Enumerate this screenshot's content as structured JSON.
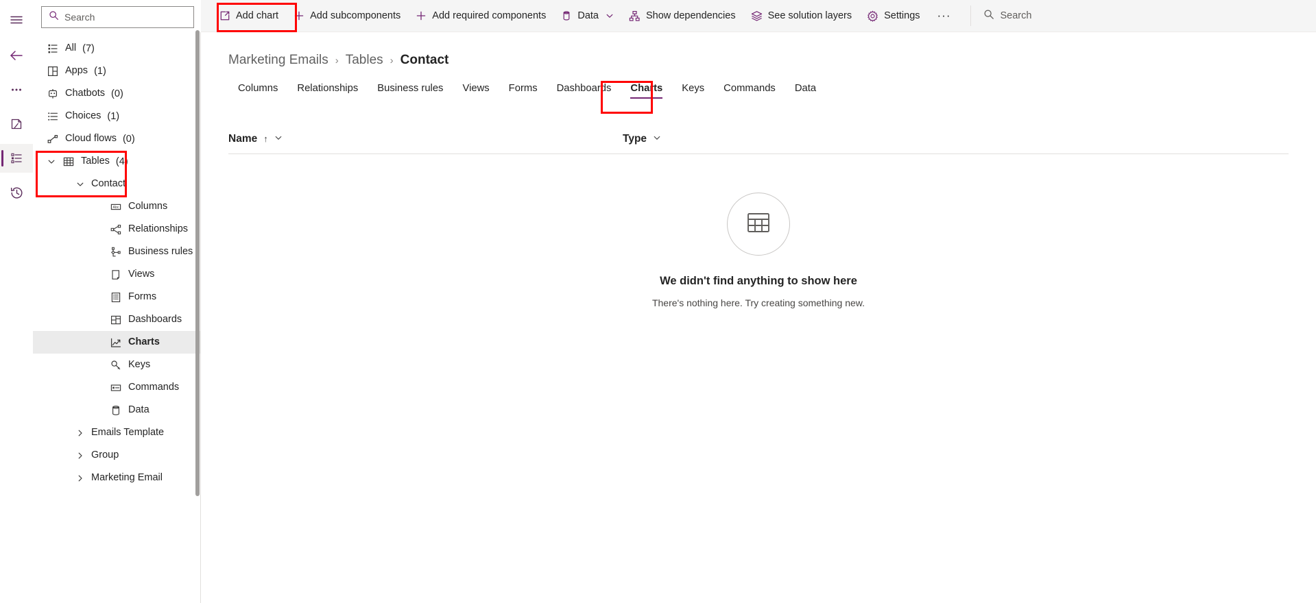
{
  "rail": {
    "items": [
      {
        "name": "hamburger-menu-icon",
        "label": "Menu"
      },
      {
        "name": "back-arrow-icon",
        "label": "Back"
      },
      {
        "name": "more-options-icon",
        "label": "More"
      },
      {
        "name": "solutions-icon",
        "label": "Solutions"
      },
      {
        "name": "objects-list-icon",
        "label": "Objects"
      },
      {
        "name": "recent-history-icon",
        "label": "Recent"
      }
    ]
  },
  "sidebar": {
    "search": {
      "placeholder": "Search"
    },
    "items": [
      {
        "label": "All",
        "count": "(7)",
        "icon": "list-ordered-icon",
        "level": 1,
        "chevron": "",
        "active": false
      },
      {
        "label": "Apps",
        "count": "(1)",
        "icon": "apps-grid-icon",
        "level": 1,
        "chevron": "",
        "active": false
      },
      {
        "label": "Chatbots",
        "count": "(0)",
        "icon": "chatbot-icon",
        "level": 1,
        "chevron": "",
        "active": false
      },
      {
        "label": "Choices",
        "count": "(1)",
        "icon": "choices-list-icon",
        "level": 1,
        "chevron": "",
        "active": false
      },
      {
        "label": "Cloud flows",
        "count": "(0)",
        "icon": "cloud-flow-icon",
        "level": 1,
        "chevron": "",
        "active": false
      },
      {
        "label": "Tables",
        "count": "(4)",
        "icon": "table-grid-icon",
        "level": 1,
        "chevron": "down",
        "active": false
      },
      {
        "label": "Contact",
        "count": "",
        "icon": "",
        "level": 2,
        "chevron": "down",
        "active": false
      },
      {
        "label": "Columns",
        "count": "",
        "icon": "columns-abc-icon",
        "level": 3,
        "chevron": "",
        "active": false
      },
      {
        "label": "Relationships",
        "count": "",
        "icon": "relationships-icon",
        "level": 3,
        "chevron": "",
        "active": false
      },
      {
        "label": "Business rules",
        "count": "",
        "icon": "business-rules-icon",
        "level": 3,
        "chevron": "",
        "active": false
      },
      {
        "label": "Views",
        "count": "",
        "icon": "views-page-icon",
        "level": 3,
        "chevron": "",
        "active": false
      },
      {
        "label": "Forms",
        "count": "",
        "icon": "forms-icon",
        "level": 3,
        "chevron": "",
        "active": false
      },
      {
        "label": "Dashboards",
        "count": "",
        "icon": "dashboards-icon",
        "level": 3,
        "chevron": "",
        "active": false
      },
      {
        "label": "Charts",
        "count": "",
        "icon": "charts-line-icon",
        "level": 3,
        "chevron": "",
        "active": true
      },
      {
        "label": "Keys",
        "count": "",
        "icon": "keys-icon",
        "level": 3,
        "chevron": "",
        "active": false
      },
      {
        "label": "Commands",
        "count": "",
        "icon": "commands-icon",
        "level": 3,
        "chevron": "",
        "active": false
      },
      {
        "label": "Data",
        "count": "",
        "icon": "data-cylinder-icon",
        "level": 3,
        "chevron": "",
        "active": false
      },
      {
        "label": "Emails Template",
        "count": "",
        "icon": "",
        "level": 2,
        "chevron": "right",
        "active": false
      },
      {
        "label": "Group",
        "count": "",
        "icon": "",
        "level": 2,
        "chevron": "right",
        "active": false
      },
      {
        "label": "Marketing Email",
        "count": "",
        "icon": "",
        "level": 2,
        "chevron": "right",
        "active": false
      }
    ]
  },
  "commandbar": {
    "buttons": [
      {
        "label": "Add chart",
        "icon": "open-in-new-icon",
        "chevron": false
      },
      {
        "label": "Add subcomponents",
        "icon": "plus-icon",
        "chevron": false
      },
      {
        "label": "Add required components",
        "icon": "plus-icon",
        "chevron": false
      },
      {
        "label": "Data",
        "icon": "data-cylinder-icon",
        "chevron": true
      },
      {
        "label": "Show dependencies",
        "icon": "dependencies-icon",
        "chevron": false
      },
      {
        "label": "See solution layers",
        "icon": "layers-icon",
        "chevron": false
      },
      {
        "label": "Settings",
        "icon": "gear-icon",
        "chevron": false
      }
    ],
    "overflow_label": "···",
    "search": {
      "placeholder": "Search"
    }
  },
  "breadcrumb": {
    "items": [
      {
        "label": "Marketing Emails",
        "current": false
      },
      {
        "label": "Tables",
        "current": false
      },
      {
        "label": "Contact",
        "current": true
      }
    ],
    "separator": "›"
  },
  "tabs": [
    {
      "label": "Columns",
      "active": false
    },
    {
      "label": "Relationships",
      "active": false
    },
    {
      "label": "Business rules",
      "active": false
    },
    {
      "label": "Views",
      "active": false
    },
    {
      "label": "Forms",
      "active": false
    },
    {
      "label": "Dashboards",
      "active": false
    },
    {
      "label": "Charts",
      "active": true
    },
    {
      "label": "Keys",
      "active": false
    },
    {
      "label": "Commands",
      "active": false
    },
    {
      "label": "Data",
      "active": false
    }
  ],
  "table": {
    "columns": [
      {
        "label": "Name",
        "sort": "↑",
        "has_menu": true
      },
      {
        "label": "Type",
        "sort": "",
        "has_menu": true
      }
    ],
    "rows": []
  },
  "empty_state": {
    "icon": "table-grid-icon",
    "title": "We didn't find anything to show here",
    "subtitle": "There's nothing here. Try creating something new."
  },
  "annotations": [
    {
      "name": "annot-addchart",
      "target": "Add chart"
    },
    {
      "name": "annot-tables",
      "target": "Tables (4) / Contact"
    },
    {
      "name": "annot-charts",
      "target": "Charts tab"
    }
  ],
  "colors": {
    "accent": "#742774",
    "annotation": "#ff0000",
    "commandbar_bg": "#f5f5f5",
    "active_item_bg": "#ebebeb"
  }
}
